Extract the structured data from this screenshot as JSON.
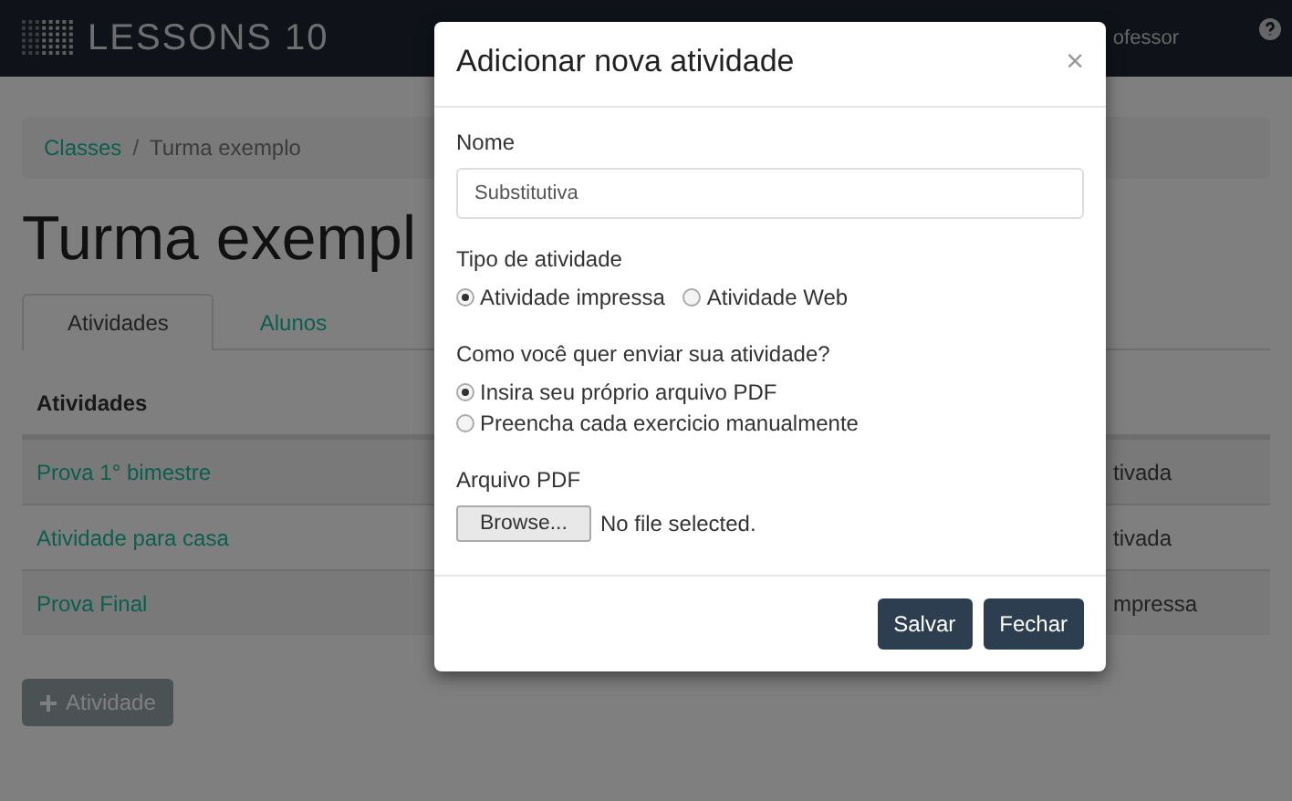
{
  "header": {
    "logo": "LESSONS 10",
    "user": "ofessor"
  },
  "breadcrumb": [
    {
      "label": "Classes",
      "link": true
    },
    {
      "label": "Turma exemplo",
      "link": false
    }
  ],
  "breadcrumb_separator": "/",
  "page_title": "Turma exempl",
  "tabs": [
    {
      "label": "Atividades",
      "selected": true
    },
    {
      "label": "Alunos",
      "selected": false
    }
  ],
  "table": {
    "column_1": "Atividades",
    "rows": [
      {
        "name": "Prova 1° bimestre",
        "column_2": "tivada"
      },
      {
        "name": "Atividade para casa",
        "column_2": "tivada"
      },
      {
        "name": "Prova Final",
        "column_2": "mpressa"
      }
    ]
  },
  "add_button": "Atividade",
  "modal": {
    "title": "Adicionar nova atividade",
    "close": "×",
    "name_label": "Nome",
    "name_value": "Substitutiva",
    "type_label": "Tipo de atividade",
    "type_options": [
      {
        "label": "Atividade impressa",
        "selected": true
      },
      {
        "label": "Atividade Web",
        "selected": false
      }
    ],
    "send_label": "Como você quer enviar sua atividade?",
    "send_options": [
      {
        "label": "Insira seu próprio arquivo PDF",
        "selected": true
      },
      {
        "label": "Preencha cada exercicio manualmente",
        "selected": false
      }
    ],
    "file_label": "Arquivo PDF",
    "browse": "Browse...",
    "file_status": "No file selected.",
    "buttons": [
      "Salvar",
      "Fechar"
    ]
  }
}
